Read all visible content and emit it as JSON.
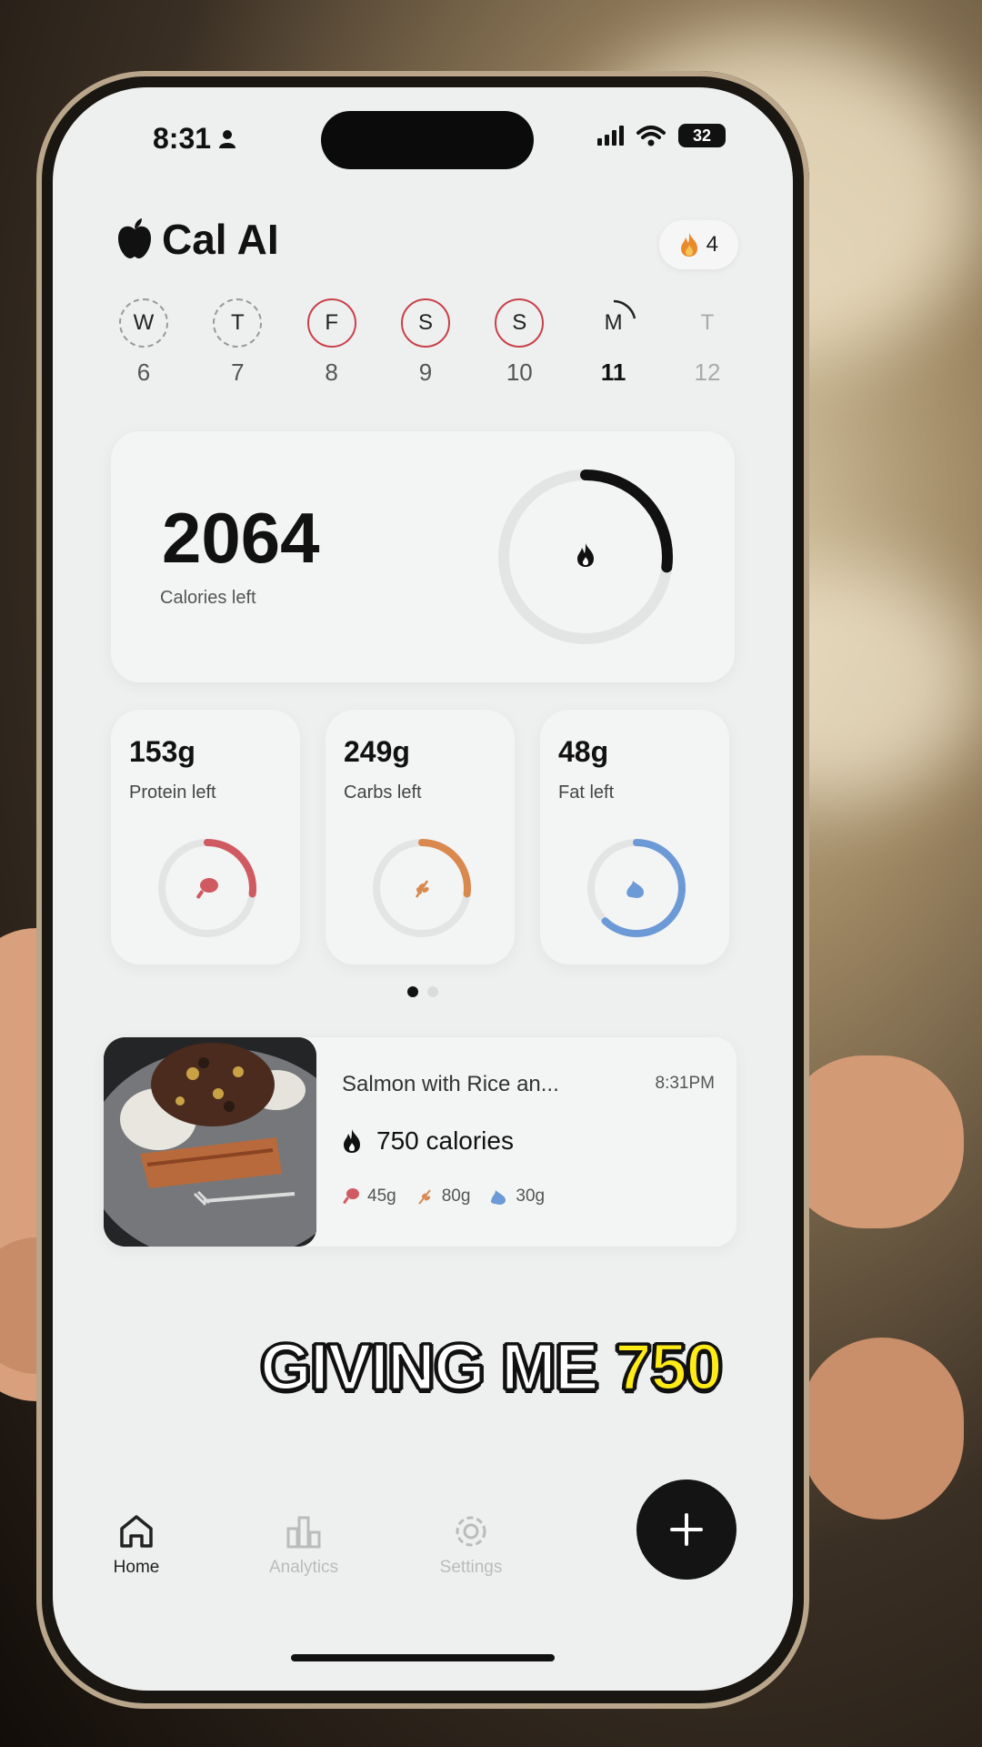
{
  "status_bar": {
    "time": "8:31",
    "battery": "32"
  },
  "app": {
    "title": "Cal AI",
    "streak_count": "4"
  },
  "week": [
    {
      "letter": "W",
      "number": "6",
      "style": "dashed"
    },
    {
      "letter": "T",
      "number": "7",
      "style": "dashed"
    },
    {
      "letter": "F",
      "number": "8",
      "style": "red"
    },
    {
      "letter": "S",
      "number": "9",
      "style": "red"
    },
    {
      "letter": "S",
      "number": "10",
      "style": "red"
    },
    {
      "letter": "M",
      "number": "11",
      "style": "today"
    },
    {
      "letter": "T",
      "number": "12",
      "style": "none"
    }
  ],
  "calories": {
    "value": "2064",
    "label": "Calories left",
    "progress": 0.27
  },
  "macros": {
    "protein": {
      "value": "153g",
      "label": "Protein left",
      "progress": 0.27,
      "color": "#d05a62"
    },
    "carbs": {
      "value": "249g",
      "label": "Carbs left",
      "progress": 0.27,
      "color": "#d9894e"
    },
    "fat": {
      "value": "48g",
      "label": "Fat left",
      "progress": 0.62,
      "color": "#6c9ad6"
    }
  },
  "page_dots": {
    "count": 2,
    "active": 0
  },
  "food_log": {
    "name": "Salmon with Rice an...",
    "time": "8:31PM",
    "calories": "750 calories",
    "protein": "45g",
    "carbs": "80g",
    "fat": "30g"
  },
  "caption": {
    "text": "GIVING ME",
    "highlight": "750"
  },
  "nav": {
    "home": "Home",
    "analytics": "Analytics",
    "settings": "Settings"
  }
}
